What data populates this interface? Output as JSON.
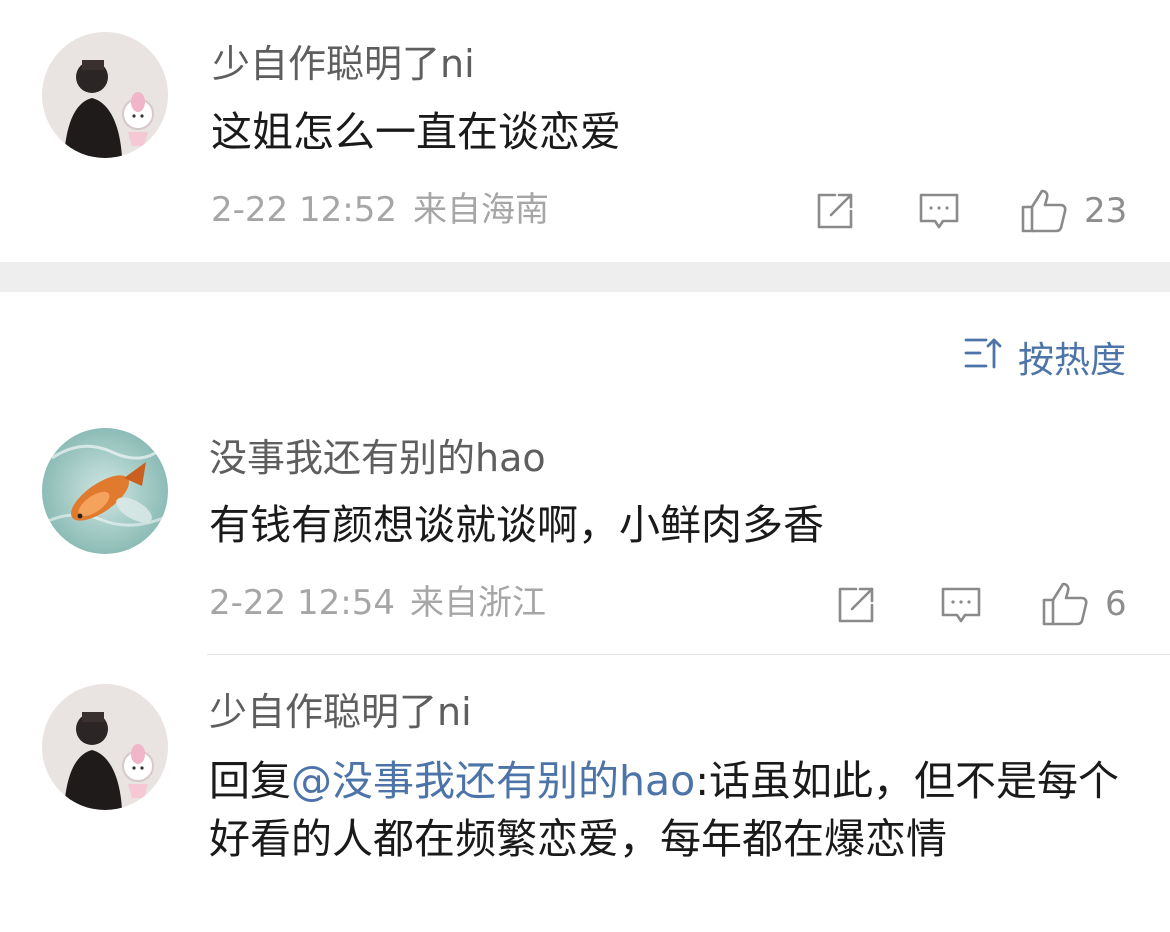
{
  "top_comment": {
    "username": "少自作聪明了ni",
    "content": "这姐怎么一直在谈恋爱",
    "date": "2-22 12:52",
    "location": "来自海南",
    "likes": "23"
  },
  "sort_button": {
    "label": "按热度"
  },
  "comments": [
    {
      "username": "没事我还有别的hao",
      "content": "有钱有颜想谈就谈啊，小鲜肉多香",
      "date": "2-22 12:54",
      "location": "来自浙江",
      "likes": "6"
    },
    {
      "username": "少自作聪明了ni",
      "reply_prefix": "回复",
      "mention": "@没事我还有别的hao",
      "content": ":话虽如此，但不是每个好看的人都在频繁恋爱，每年都在爆恋情"
    }
  ],
  "colors": {
    "link": "#4c74a8",
    "meta_text": "#a6a6a6",
    "username": "#5e5e5e",
    "body_text": "#1a1a1a",
    "separator": "#eeeeee"
  },
  "icons": {
    "share": "share-icon",
    "comment": "comment-icon",
    "like": "thumbs-up-icon",
    "sort": "sort-icon"
  }
}
